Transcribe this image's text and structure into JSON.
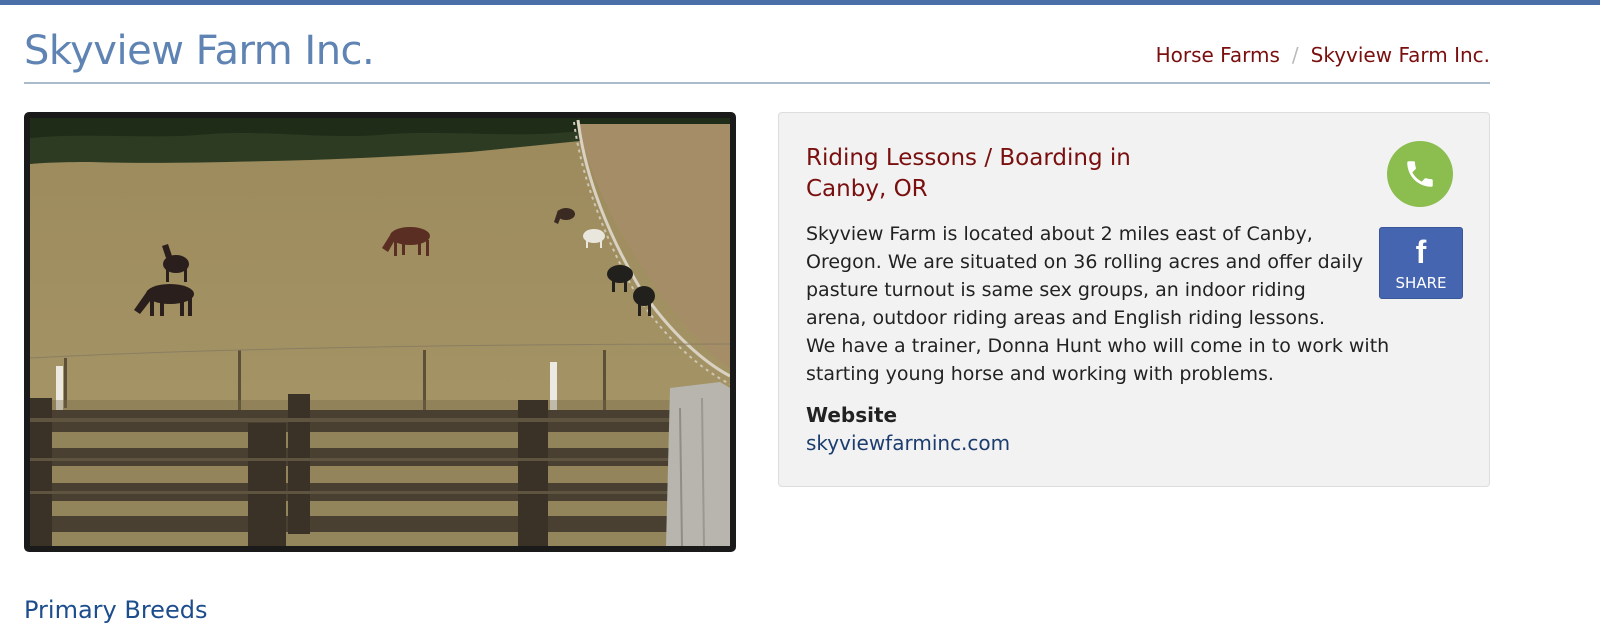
{
  "page": {
    "title": "Skyview Farm Inc."
  },
  "breadcrumb": {
    "items": [
      "Horse Farms",
      "Skyview Farm Inc."
    ],
    "separator": "/"
  },
  "photo": {
    "description_icon": "farm-photo"
  },
  "card": {
    "heading": "Riding Lessons / Boarding in Canby, OR",
    "phone_icon": "phone-icon",
    "share_label": "SHARE",
    "share_icon": "facebook-icon",
    "description_p1": "Skyview Farm is located about 2 miles east of Canby, Oregon. We are situated on 36 rolling acres and offer daily pasture turnout is same sex groups, an indoor riding arena, outdoor riding areas and English riding lessons.",
    "description_p2": "We have a trainer, Donna Hunt who will come in to work with starting young horse and working with problems.",
    "website_label": "Website",
    "website_url": "skyviewfarminc.com"
  },
  "sections": {
    "primary_breeds": "Primary Breeds"
  },
  "colors": {
    "accent_blue": "#5f84b3",
    "link_red": "#7a0f0f",
    "phone_green": "#8bbd4f",
    "facebook_blue": "#4565b0"
  }
}
